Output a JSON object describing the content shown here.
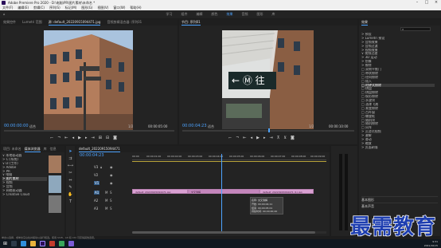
{
  "app": {
    "title": "Adobe Premiere Pro 2020 - D:\\电脑\\PR\\图片素材\\未命名 *"
  },
  "menu": [
    "文件(F)",
    "编辑(E)",
    "剪辑(C)",
    "序列(S)",
    "标记(M)",
    "图形(G)",
    "视图(V)",
    "窗口(W)",
    "帮助(H)"
  ],
  "workspaces": {
    "items": [
      "学习",
      "组件",
      "编辑",
      "颜色",
      "效果",
      "音频",
      "图形",
      "库"
    ],
    "active": "效果"
  },
  "source_monitor": {
    "tabs": [
      "效果控件",
      "Lumetri 范围",
      "源: default_20220915094471.jpg",
      "音频剪辑混合器: 序列01"
    ],
    "timecode": "00:00:00:00",
    "fit": "适合",
    "ratio": "1/2",
    "duration": "00:00:05:00"
  },
  "program_monitor": {
    "tab": "节目: 序列01",
    "timecode": "00:00:04:23",
    "fit": "适合",
    "ratio": "1/2",
    "duration": "00:00:10:00"
  },
  "project": {
    "tabs": [
      "项目: 未命名",
      "媒体浏览器",
      "库",
      "信息"
    ],
    "tree": [
      "∨ 本地驱动器",
      "  > C:(系统)",
      "  ∨ D:(工作)",
      "    > Adobe",
      "    > PR",
      "    ∨ 电脑",
      "      > 图片素材",
      "    > 视频",
      "    > 音频",
      "  > 网络驱动器",
      "  > Creative Cloud"
    ]
  },
  "timeline": {
    "tab": "default_20220915094471",
    "timecode": "00:00:04:23",
    "ruler": [
      "00:00",
      "00:00:01:00",
      "00:00:02:00",
      "00:00:03:00",
      "00:00:04:00",
      "00:00:05:00",
      "00:00:06:00",
      "00:00:07:00",
      "00:00:08:00",
      "00:00:09:00"
    ],
    "tracks": [
      "V3",
      "V2",
      "V1",
      "A1",
      "A2",
      "A3"
    ],
    "clips": {
      "clip1": "default_20220915094471.jpg",
      "transition": "交叉溶解",
      "clip2": "default_20220915094471 (1).jpg"
    },
    "tooltip": [
      "名称: 交叉溶解",
      "开始: 00;00;04;11",
      "结束: 00;00;05;01",
      "持续时间: 00;00;00;20"
    ]
  },
  "effects": {
    "title": "效果",
    "tree": [
      "> 预设",
      "> Lumetri 预设",
      "> 音频效果",
      "> 音频过渡",
      "> 视频效果",
      "∨ 视频过渡",
      "  > 3D 运动",
      "  > 划像",
      "  > 擦除",
      "    □ 双侧平推门",
      "    □ 带状擦除",
      "    □ 径向擦除",
      "    □ 插入",
      "    □ 时钟式擦除",
      "    □ 棋盘",
      "    □ 棋盘擦除",
      "    □ 楔形擦除",
      "    □ 水波块",
      "    □ 油漆飞溅",
      "    □ 渐变擦除",
      "    □ 百叶窗",
      "    □ 螺旋框",
      "    □ 随机块",
      "    □ 随机擦除",
      "    □ 风车",
      "  > 沉浸式视频",
      "  > 溶解",
      "  > 滑动",
      "  > 缩放",
      "  > 页面剥落"
    ],
    "highlight_index": 13,
    "sections": [
      "基本图形",
      "基本声音"
    ]
  },
  "status": "单击以选择，或单击空白处并拖动以进行框选。使用 Shift、Alt 和 Ctrl 可获得其他选项。",
  "taskbar": {
    "time": "9:31",
    "date": "2021/10/15"
  },
  "watermark": "最需教育",
  "colors": {
    "accent": "#4da3ff",
    "clip": "#d9a0d2",
    "watermark": "#1f3fb0"
  }
}
